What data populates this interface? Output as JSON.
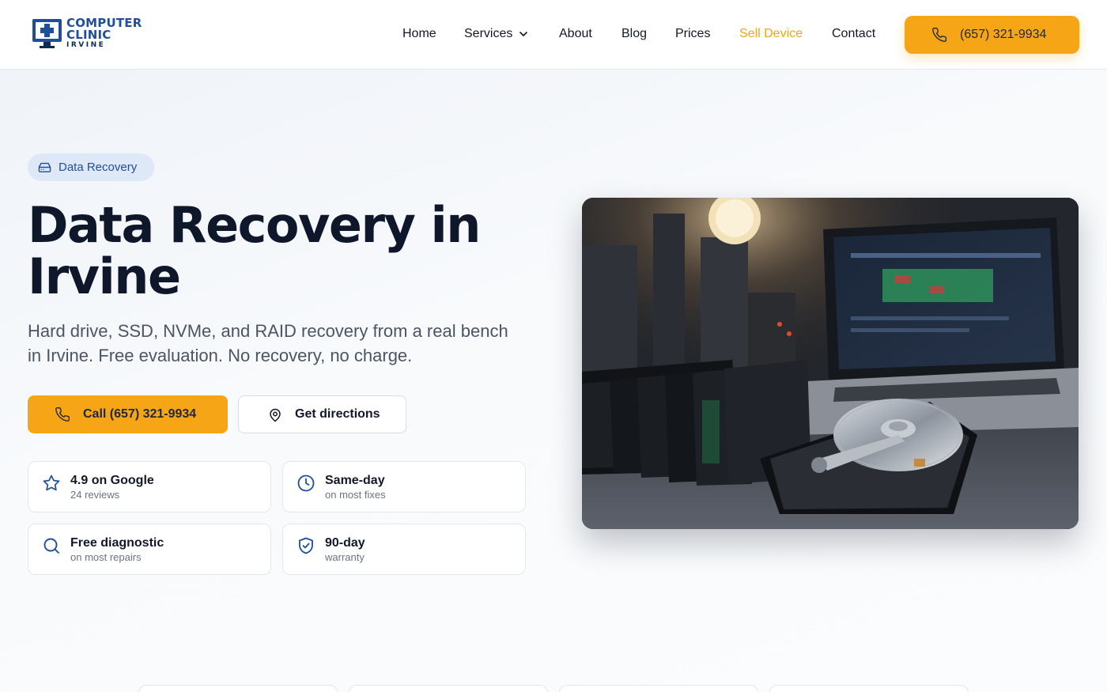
{
  "brand": {
    "line1": "COMPUTER",
    "line2": "CLINIC",
    "line3": "IRVINE",
    "primary_color": "#1e4f9b",
    "accent_color": "#f5a516"
  },
  "nav": {
    "items": [
      {
        "label": "Home"
      },
      {
        "label": "Services",
        "has_dropdown": true
      },
      {
        "label": "About"
      },
      {
        "label": "Blog"
      },
      {
        "label": "Prices"
      },
      {
        "label": "Sell Device",
        "highlighted": true
      },
      {
        "label": "Contact"
      }
    ],
    "cta_label": "(657) 321-9934"
  },
  "hero": {
    "badge": "Data Recovery",
    "title": "Data Recovery in Irvine",
    "subtitle": "Hard drive, SSD, NVMe, and RAID recovery from a real bench in Irvine. Free evaluation. No recovery, no charge.",
    "primary_button": "Call (657) 321-9934",
    "secondary_button": "Get directions",
    "features": [
      {
        "icon": "star-icon",
        "title": "4.9 on Google",
        "subtitle": "24 reviews"
      },
      {
        "icon": "clock-icon",
        "title": "Same-day",
        "subtitle": "on most fixes"
      },
      {
        "icon": "search-icon",
        "title": "Free diagnostic",
        "subtitle": "on most repairs"
      },
      {
        "icon": "shield-check-icon",
        "title": "90-day",
        "subtitle": "warranty"
      }
    ]
  }
}
